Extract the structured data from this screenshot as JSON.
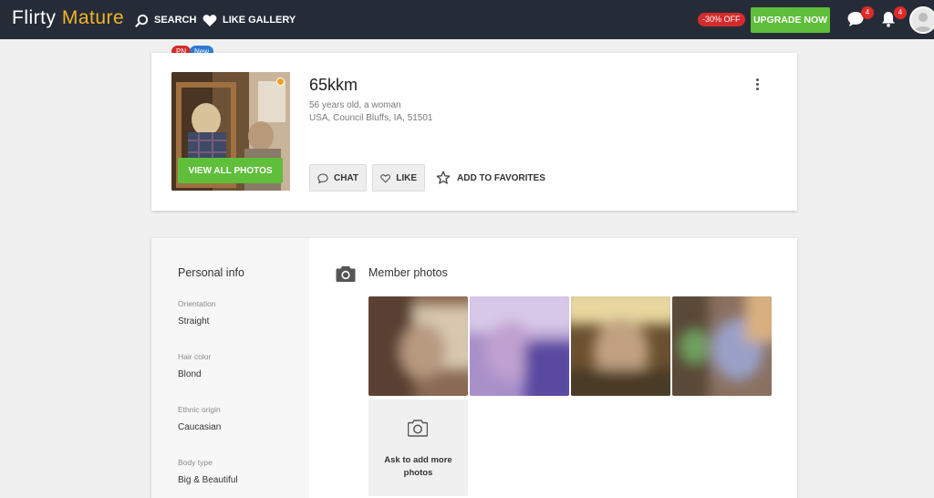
{
  "header": {
    "logo_part1": "Flirty ",
    "logo_part2": "Mature",
    "nav": {
      "search": "SEARCH",
      "like_gallery": "LIKE GALLERY"
    },
    "discount": "-30% OFF",
    "upgrade": "UPGRADE NOW",
    "chat_count": "4",
    "notifications_count": "4",
    "icons": [
      "search-icon",
      "heart-icon",
      "chat-bubble-icon",
      "bell-icon",
      "avatar"
    ]
  },
  "profile": {
    "tags": {
      "pn": "PN",
      "new": "New"
    },
    "username": "65kkm",
    "age_gender": "56 years old, a woman",
    "location": "USA, Council Bluffs, IA, 51501",
    "view_all_photos": "VIEW ALL PHOTOS",
    "actions": {
      "chat": "CHAT",
      "like": "LIKE",
      "favorites": "ADD TO FAVORITES"
    },
    "online_status_color": "#f0a020"
  },
  "personal_info": {
    "title": "Personal info",
    "fields": [
      {
        "label": "Orientation",
        "value": "Straight"
      },
      {
        "label": "Hair color",
        "value": "Blond"
      },
      {
        "label": "Ethnic origin",
        "value": "Caucasian"
      },
      {
        "label": "Body type",
        "value": "Big & Beautiful"
      }
    ]
  },
  "member_photos": {
    "title": "Member photos",
    "thumbnail_count": 4,
    "ask_more": "Ask to add more photos"
  },
  "colors": {
    "topbar": "#262c37",
    "accent_green": "#5fbe3a",
    "badge_red": "#d42c2c",
    "logo_accent": "#f0b429"
  }
}
